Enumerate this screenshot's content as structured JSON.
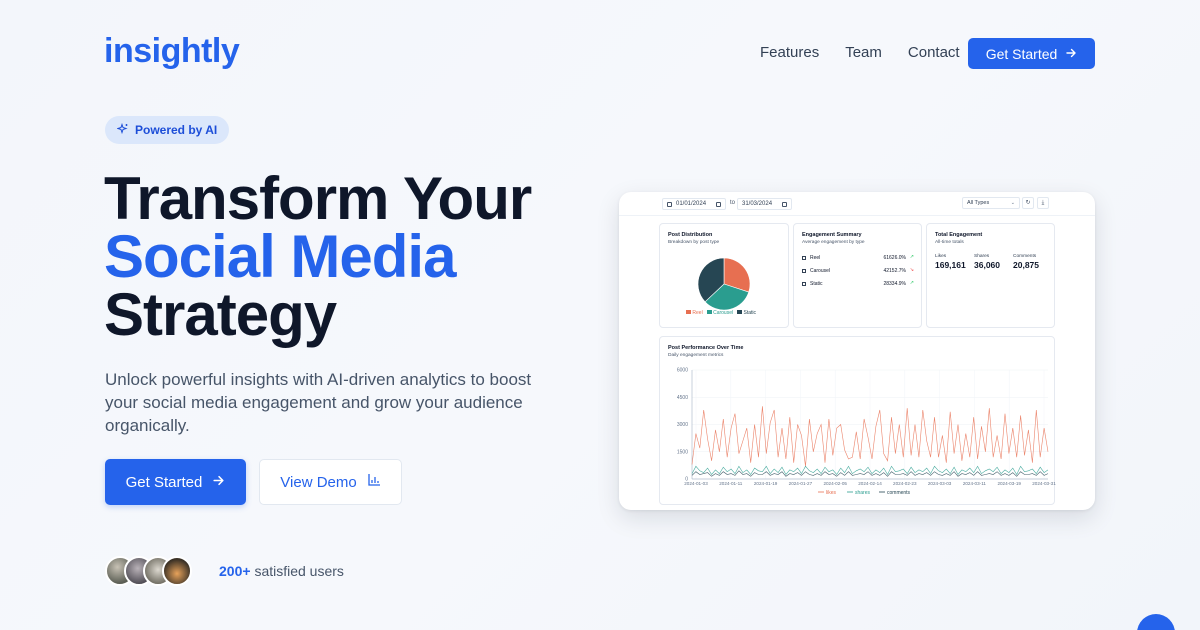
{
  "brand": {
    "name": "insightly"
  },
  "nav": {
    "links": [
      "Features",
      "Team",
      "Contact"
    ],
    "cta": "Get Started"
  },
  "hero": {
    "badge": "Powered by AI",
    "title_line1": "Transform Your",
    "title_line2": "Social Media",
    "title_line3": "Strategy",
    "subtitle": "Unlock powerful insights with AI-driven analytics to boost your social media engagement and grow your audience organically.",
    "primary_cta": "Get Started",
    "secondary_cta": "View Demo",
    "users_count": "200+",
    "users_label": "satisfied users"
  },
  "colors": {
    "brand": "#2563eb",
    "reel": "#e76f51",
    "carousel": "#2a9d8f",
    "static": "#264653"
  },
  "dashboard": {
    "date_from": "01/01/2024",
    "date_to": "31/03/2024",
    "to_label": "to",
    "type_filter": "All Types",
    "post_distribution": {
      "title": "Post Distribution",
      "subtitle": "Breakdown by post type",
      "legend": [
        "Reel",
        "Carousel",
        "Static"
      ]
    },
    "engagement_summary": {
      "title": "Engagement Summary",
      "subtitle": "Average engagement by type",
      "rows": [
        {
          "label": "Reel",
          "value": "61626.0%",
          "trend": "up"
        },
        {
          "label": "Carousel",
          "value": "42152.7%",
          "trend": "down"
        },
        {
          "label": "Static",
          "value": "28334.9%",
          "trend": "up"
        }
      ]
    },
    "total_engagement": {
      "title": "Total Engagement",
      "subtitle": "All-time totals",
      "stats": [
        {
          "label": "Likes",
          "value": "169,161"
        },
        {
          "label": "Shares",
          "value": "36,060"
        },
        {
          "label": "Comments",
          "value": "20,875"
        }
      ]
    },
    "performance": {
      "title": "Post Performance Over Time",
      "subtitle": "Daily engagement metrics"
    }
  },
  "chart_data": [
    {
      "type": "pie",
      "categories": [
        "Reel",
        "Carousel",
        "Static"
      ],
      "values": [
        30,
        33,
        37
      ]
    },
    {
      "type": "line",
      "ylim": [
        0,
        6000
      ],
      "yticks": [
        0,
        1500,
        3000,
        4500,
        6000
      ],
      "xticks": [
        "2024-01-03",
        "2024-01-11",
        "2024-01-19",
        "2024-01-27",
        "2024-02-05",
        "2024-02-14",
        "2024-02-23",
        "2024-03-03",
        "2024-03-11",
        "2024-03-19",
        "2024-03-31"
      ],
      "series": [
        {
          "name": "likes",
          "color": "#e76f51",
          "values": [
            800,
            2500,
            1700,
            3800,
            2200,
            1000,
            2700,
            1500,
            3300,
            1200,
            2800,
            3600,
            1400,
            2100,
            2800,
            900,
            3000,
            1200,
            4000,
            1400,
            3100,
            3800,
            1200,
            2800,
            1100,
            3400,
            900,
            3000,
            2400,
            700,
            3300,
            1500,
            2500,
            3000,
            900,
            3300,
            1300,
            2800,
            3000,
            1600,
            1100,
            1200,
            2600,
            1100,
            3300,
            2300,
            1100,
            2900,
            3800,
            1400,
            1000,
            3400,
            1400,
            3000,
            1200,
            3900,
            1300,
            3000,
            1200,
            3800,
            2100,
            1200,
            3400,
            1200,
            2400,
            900,
            3700,
            1400,
            3000,
            1000,
            2500,
            1200,
            3400,
            1100,
            2900,
            1500,
            3900,
            1200,
            2400,
            1100,
            3600,
            1400,
            2800,
            1200,
            3500,
            1300,
            2700,
            900,
            3800,
            1200,
            2800,
            1500
          ]
        },
        {
          "name": "shares",
          "color": "#2a9d8f",
          "values": [
            300,
            700,
            450,
            350,
            600,
            250,
            500,
            300,
            650,
            400,
            550,
            300,
            700,
            350,
            500,
            250,
            600,
            450,
            400,
            700,
            300,
            550,
            350,
            650,
            250,
            500,
            400,
            600,
            300,
            700,
            450,
            350,
            550,
            300,
            650,
            400,
            500,
            250,
            600,
            350,
            700,
            300,
            450,
            550,
            400,
            650,
            300,
            500,
            350,
            600,
            250,
            700,
            400,
            450,
            550,
            300,
            650,
            350,
            500,
            400,
            600,
            300,
            700,
            450,
            350,
            550,
            300,
            650,
            250,
            500,
            400,
            600,
            350,
            700,
            300,
            450,
            550,
            400,
            650,
            300,
            500,
            350,
            600,
            250,
            700,
            400,
            450,
            550,
            300,
            650,
            350,
            500
          ]
        },
        {
          "name": "comments",
          "color": "#264653",
          "values": [
            200,
            400,
            250,
            300,
            350,
            150,
            300,
            200,
            400,
            250,
            300,
            200,
            450,
            250,
            300,
            150,
            350,
            250,
            250,
            400,
            200,
            300,
            250,
            400,
            150,
            300,
            250,
            350,
            200,
            400,
            250,
            200,
            300,
            200,
            400,
            250,
            300,
            150,
            350,
            200,
            400,
            200,
            250,
            300,
            250,
            400,
            200,
            300,
            200,
            350,
            150,
            400,
            250,
            250,
            300,
            200,
            400,
            200,
            300,
            250,
            350,
            200,
            400,
            250,
            200,
            300,
            200,
            400,
            150,
            300,
            250,
            350,
            200,
            400,
            200,
            250,
            300,
            250,
            400,
            200,
            300,
            200,
            350,
            150,
            400,
            250,
            250,
            300,
            200,
            400,
            200,
            300
          ]
        }
      ]
    }
  ]
}
